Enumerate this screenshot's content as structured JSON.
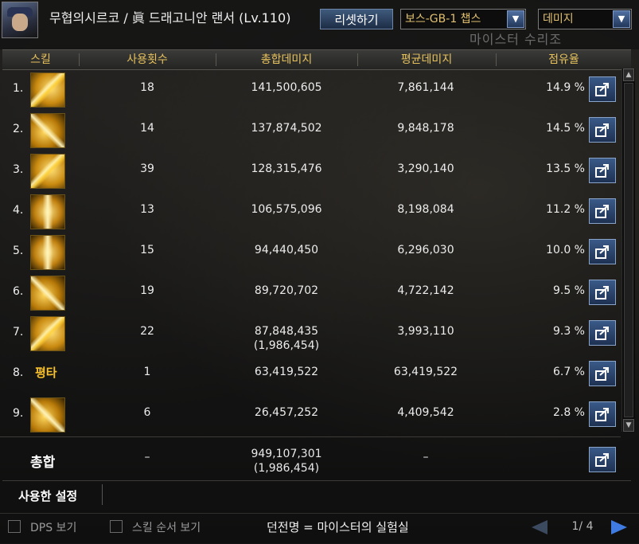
{
  "header_bar": {
    "character": "무협의시르코 / 眞 드래고니안 랜서 (Lv.110)",
    "reset_label": "리셋하기",
    "boss_select": "보스-GB-1 챕스",
    "type_select": "데미지",
    "bg_text": "마이스터 수리조"
  },
  "columns": {
    "skill": "스킬",
    "count": "사용횟수",
    "total": "총합데미지",
    "avg": "평균데미지",
    "share": "점유율"
  },
  "rows": [
    {
      "idx": "1.",
      "icon": "skill-slash-icon",
      "count": "18",
      "total": "141,500,605",
      "total_sub": "",
      "avg": "7,861,144",
      "share": "14.9 %"
    },
    {
      "idx": "2.",
      "icon": "skill-spear-thrust-icon",
      "count": "14",
      "total": "137,874,502",
      "total_sub": "",
      "avg": "9,848,178",
      "share": "14.5 %"
    },
    {
      "idx": "3.",
      "icon": "skill-lance-strike-icon",
      "count": "39",
      "total": "128,315,476",
      "total_sub": "",
      "avg": "3,290,140",
      "share": "13.5 %"
    },
    {
      "idx": "4.",
      "icon": "skill-dragon-drill-icon",
      "count": "13",
      "total": "106,575,096",
      "total_sub": "",
      "avg": "8,198,084",
      "share": "11.2 %"
    },
    {
      "idx": "5.",
      "icon": "skill-charge-icon",
      "count": "15",
      "total": "94,440,450",
      "total_sub": "",
      "avg": "6,296,030",
      "share": "10.0 %"
    },
    {
      "idx": "6.",
      "icon": "skill-multi-thrust-icon",
      "count": "19",
      "total": "89,720,702",
      "total_sub": "",
      "avg": "4,722,142",
      "share": "9.5 %"
    },
    {
      "idx": "7.",
      "icon": "skill-burst-icon",
      "count": "22",
      "total": "87,848,435",
      "total_sub": "(1,986,454)",
      "avg": "3,993,110",
      "share": "9.3 %"
    },
    {
      "idx": "8.",
      "icon": "평타",
      "count": "1",
      "total": "63,419,522",
      "total_sub": "",
      "avg": "63,419,522",
      "share": "6.7 %"
    },
    {
      "idx": "9.",
      "icon": "skill-whirl-icon",
      "count": "6",
      "total": "26,457,252",
      "total_sub": "",
      "avg": "4,409,542",
      "share": "2.8 %"
    }
  ],
  "total": {
    "label": "총합",
    "count": "–",
    "sum": "949,107,301",
    "sum_sub": "(1,986,454)",
    "avg": "–"
  },
  "settings_label": "사용한 설정",
  "footer": {
    "dps_label": "DPS 보기",
    "order_label": "스킬 순서 보기",
    "dungeon": "던전명 = 마이스터의 실험실",
    "page": "1/ 4"
  },
  "colors": {
    "header_text": "#e6c15c",
    "button_blue": "#3a5a88",
    "select_text": "#e0c070"
  }
}
